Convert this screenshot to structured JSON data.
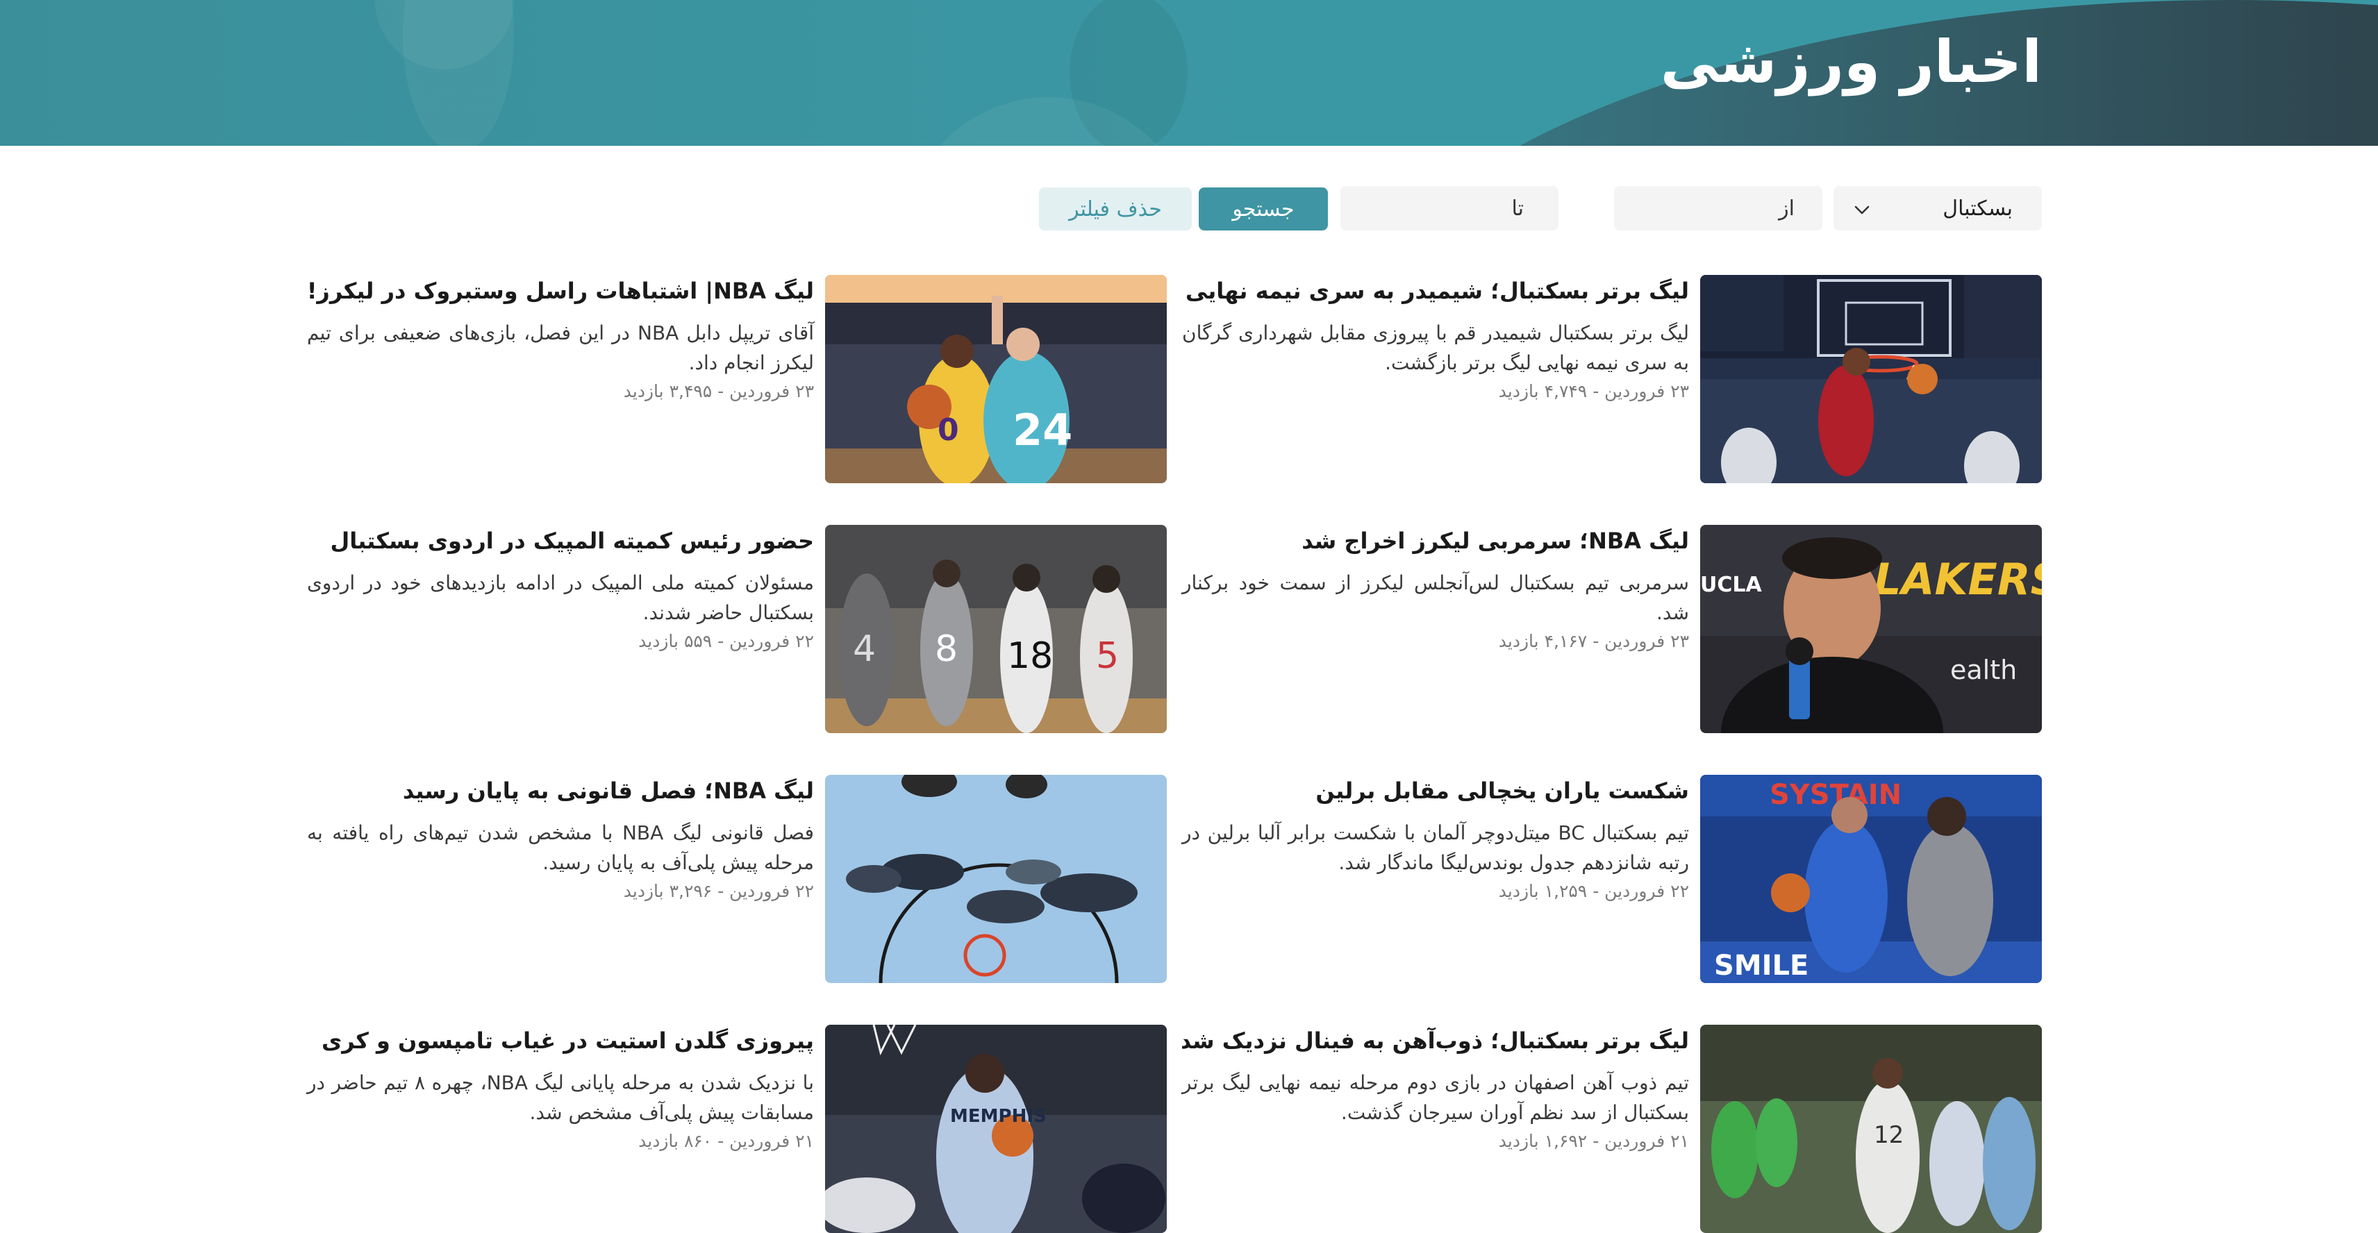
{
  "header": {
    "title": "اخبار ورزشی"
  },
  "filters": {
    "sport_selected": "بسکتبال",
    "from_label": "از",
    "to_label": "تا",
    "search_label": "جستجو",
    "clear_label": "حذف فیلتر"
  },
  "meta_separator": " - ",
  "news": [
    {
      "title": "لیگ برتر بسکتبال؛ شیمیدر به سری نیمه نهایی برگشت",
      "summary": "لیگ برتر بسکتبال شیمیدر قم با پیروزی مقابل شهرداری گرگان به سری نیمه نهایی لیگ برتر بازگشت.",
      "date": "۲۳ فروردین",
      "views": "۴,۷۴۹ بازدید",
      "image": "dunk-icon"
    },
    {
      "title": "لیگ NBA| اشتباهات راسل وستبروک در لیکرز!",
      "summary": "آقای تریپل دابل NBA در این فصل، بازی‌های ضعیفی برای تیم لیکرز انجام داد.",
      "date": "۲۳ فروردین",
      "views": "۳,۴۹۵ بازدید",
      "image": "lakers-vs-hornets-icon"
    },
    {
      "title": "لیگ NBA؛ سرمربی لیکرز اخراج شد",
      "summary": "سرمربی تیم بسکتبال لس‌آنجلس لیکرز از سمت خود برکنار شد.",
      "date": "۲۳ فروردین",
      "views": "۴,۱۶۷ بازدید",
      "image": "coach-press-icon"
    },
    {
      "title": "حضور رئیس کمیته المپیک در اردوی بسکتبال",
      "summary": "مسئولان کمیته ملی المپیک در ادامه بازدیدهای خود در اردوی بسکتبال حاضر شدند.",
      "date": "۲۲ فروردین",
      "views": "۵۵۹ بازدید",
      "image": "team-camp-icon"
    },
    {
      "title": "شکست یاران یخچالی مقابل برلین",
      "summary": "تیم بسکتبال BC میتل‌دوچر آلمان با شکست برابر آلبا برلین در رتبه شانزدهم جدول بوندس‌لیگا ماندگار شد.",
      "date": "۲۲ فروردین",
      "views": "۱,۲۵۹ بازدید",
      "image": "dribble-icon"
    },
    {
      "title": "لیگ NBA؛ فصل قانونی به پایان رسید",
      "summary": "فصل قانونی لیگ NBA با مشخص شدن تیم‌های راه یافته به مرحله پیش پلی‌آف به پایان رسید.",
      "date": "۲۲ فروردین",
      "views": "۳,۲۹۶ بازدید",
      "image": "overhead-court-icon"
    },
    {
      "title": "لیگ برتر بسکتبال؛ ذوب‌آهن به فینال نزدیک شد",
      "summary": "تیم ذوب آهن اصفهان در بازی دوم مرحله نیمه نهایی لیگ برتر بسکتبال از سد نظم آوران سیرجان گذشت.",
      "date": "۲۱ فروردین",
      "views": "۱,۶۹۲ بازدید",
      "image": "zob-ahan-icon"
    },
    {
      "title": "پیروزی گلدن استیت در غیاب تامپسون و کری",
      "summary": "با نزدیک شدن به مرحله پایانی لیگ NBA، چهره ۸ تیم حاضر در مسابقات پیش پلی‌آف مشخص شد.",
      "date": "۲۱ فروردین",
      "views": "۸۶۰ بازدید",
      "image": "grizzlies-icon"
    }
  ]
}
